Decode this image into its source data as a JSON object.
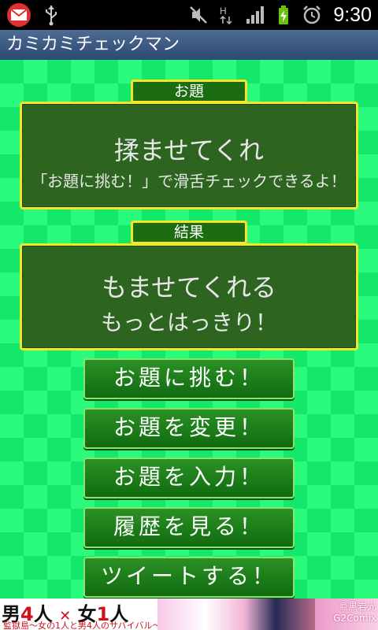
{
  "status_bar": {
    "time": "9:30",
    "network": "H"
  },
  "app": {
    "title": "カミカミチェックマン"
  },
  "topic": {
    "label": "お題",
    "word": "揉ませてくれ",
    "hint": "「お題に挑む！」で滑舌チェックできるよ！"
  },
  "result": {
    "label": "結果",
    "word": "もませてくれる",
    "comment": "もっとはっきり！"
  },
  "buttons": {
    "challenge": "お題に挑む！",
    "change": "お題を変更！",
    "input": "お題を入力！",
    "history": "履歴を見る！",
    "tweet": "ツイートする！"
  },
  "ad": {
    "title_a": "男",
    "title_b": "4",
    "title_c": "人",
    "title_d": "女",
    "title_e": "1",
    "title_f": "人",
    "subtitle": "監獄島～女の1人と男4人のサバイバル～",
    "credit_a": "©黒岩光",
    "credit_b": "G2Comix"
  },
  "colors": {
    "background": "#14e86a",
    "pattern": "#2bfb7c",
    "board": "#2c6420",
    "border": "#f3e62a",
    "title_bar": "#3a5a84"
  }
}
